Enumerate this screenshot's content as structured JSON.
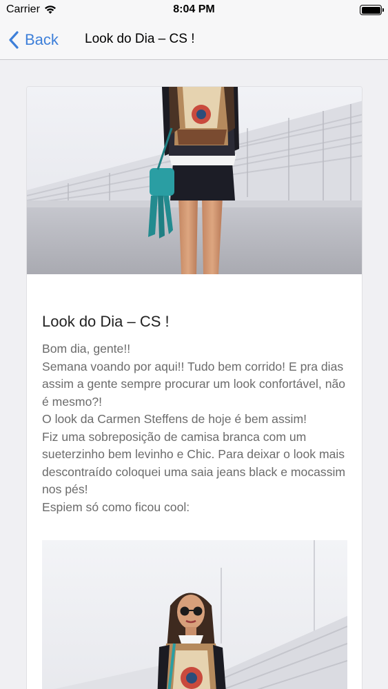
{
  "status_bar": {
    "carrier": "Carrier",
    "time": "8:04 PM"
  },
  "nav": {
    "back_label": "Back",
    "title": "Look do Dia – CS !"
  },
  "post": {
    "title": "Look do Dia – CS !",
    "paragraphs": [
      "Bom dia, gente!!",
      "Semana voando por aqui!! Tudo bem corrido! E pra dias assim a gente sempre procurar um look confortável, não é mesmo?!",
      "O look da Carmen Steffens de hoje é bem assim!",
      "Fiz uma sobreposição de camisa branca com um sueterzinho bem levinho e Chic. Para deixar o look mais descontraído coloquei uma saia jeans black e mocassim nos pés!",
      "Espiem só como ficou cool:"
    ]
  },
  "colors": {
    "accent": "#3d7fd9",
    "bag": "#2a9ea3"
  },
  "icons": {
    "wifi": "wifi-icon",
    "battery": "battery-icon",
    "back": "chevron-left-icon"
  }
}
